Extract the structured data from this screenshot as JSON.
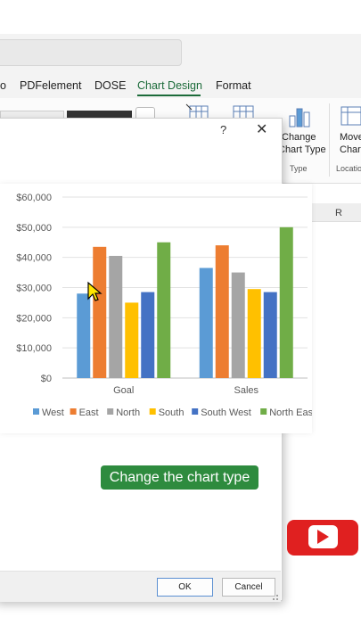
{
  "ribbon": {
    "tabs": [
      {
        "label": "o"
      },
      {
        "label": "PDFelement"
      },
      {
        "label": "DOSE"
      },
      {
        "label": "Chart Design"
      },
      {
        "label": "Format"
      }
    ],
    "change_chart_type": {
      "line1": "Change",
      "line2": "Chart Type",
      "group": "Type"
    },
    "move_chart": {
      "line1": "Move",
      "line2": "Char",
      "group": "Locatio"
    }
  },
  "dialog": {
    "help": "?",
    "close": "✕",
    "ok_label": "OK",
    "cancel_label": "Cancel"
  },
  "sheet": {
    "column": "R"
  },
  "caption": "Change the chart type",
  "colors": {
    "West": "#5b9bd5",
    "East": "#ed7d31",
    "North": "#a5a5a5",
    "South": "#ffc000",
    "South West": "#4472c4",
    "North East": "#70ad47",
    "accent": "#1c6b3a",
    "caption_bg": "#2e8b3e"
  },
  "chart_data": {
    "type": "bar",
    "categories": [
      "Goal",
      "Sales"
    ],
    "series": [
      {
        "name": "West",
        "values": [
          28000,
          36500
        ]
      },
      {
        "name": "East",
        "values": [
          43500,
          44000
        ]
      },
      {
        "name": "North",
        "values": [
          40500,
          35000
        ]
      },
      {
        "name": "South",
        "values": [
          25000,
          29500
        ]
      },
      {
        "name": "South West",
        "values": [
          28500,
          28500
        ]
      },
      {
        "name": "North East",
        "values": [
          45000,
          50000
        ]
      }
    ],
    "yticks": [
      "$0",
      "$10,000",
      "$20,000",
      "$30,000",
      "$40,000",
      "$50,000",
      "$60,000"
    ],
    "ylim": [
      0,
      60000
    ],
    "grid": true,
    "legend": "bottom"
  }
}
